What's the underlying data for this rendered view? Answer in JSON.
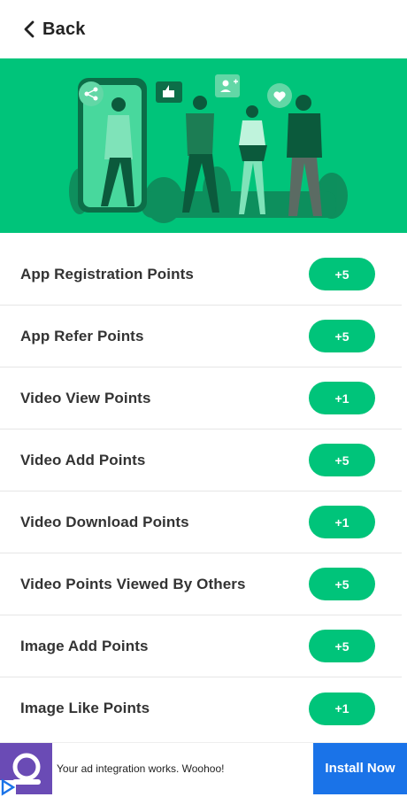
{
  "header": {
    "back_label": "Back"
  },
  "points": [
    {
      "label": "App Registration Points",
      "value": "+5"
    },
    {
      "label": "App Refer Points",
      "value": "+5"
    },
    {
      "label": "Video View Points",
      "value": "+1"
    },
    {
      "label": "Video Add Points",
      "value": "+5"
    },
    {
      "label": "Video Download Points",
      "value": "+1"
    },
    {
      "label": "Video Points Viewed By Others",
      "value": "+5"
    },
    {
      "label": "Image Add Points",
      "value": "+5"
    },
    {
      "label": "Image Like Points",
      "value": "+1"
    }
  ],
  "ad": {
    "text": "Your ad integration works. Woohoo!",
    "cta": "Install Now"
  },
  "colors": {
    "accent": "#00c47a",
    "ad_cta": "#1a73e8",
    "ad_logo_bg": "#6a4bb5"
  },
  "icons": [
    "chevron-left-icon",
    "share-icon",
    "thumbs-up-icon",
    "add-user-icon",
    "heart-icon",
    "ad-choices-icon"
  ]
}
